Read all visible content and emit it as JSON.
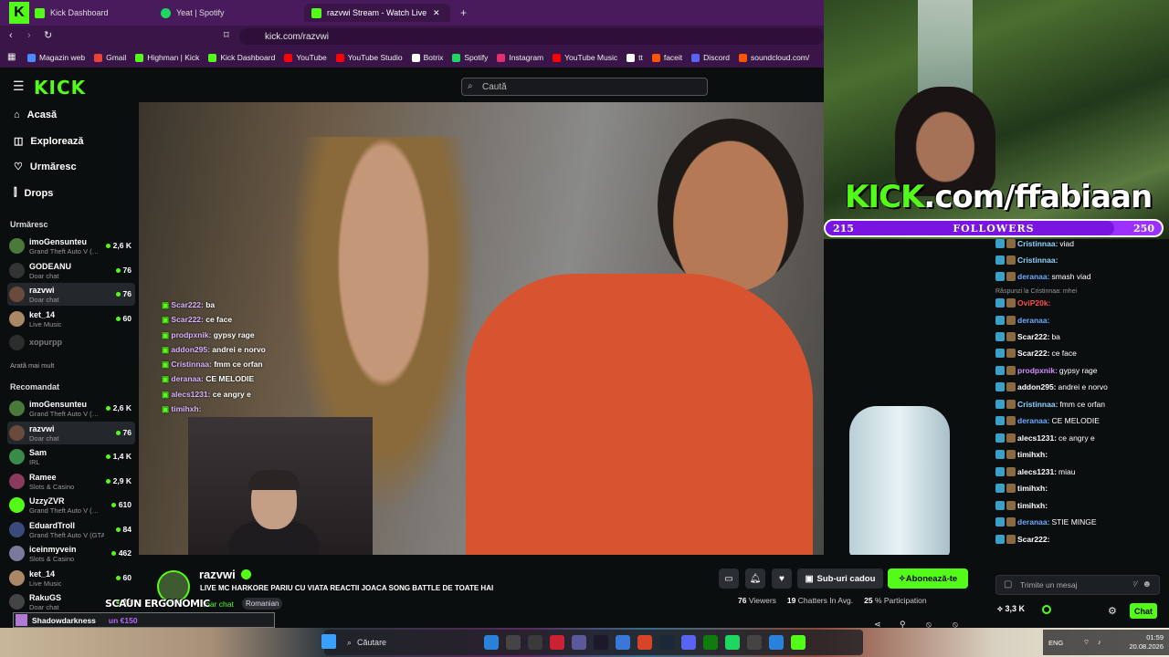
{
  "browser": {
    "tabs": [
      {
        "label": "Kick Dashboard"
      },
      {
        "label": "Yeat | Spotify"
      },
      {
        "label": "razvwi Stream - Watch Live on Kick"
      }
    ],
    "url": "kick.com/razvwi",
    "bookmarks": [
      {
        "label": "Magazin web",
        "color": "#4a8cff"
      },
      {
        "label": "Gmail",
        "color": "#ea4335"
      },
      {
        "label": "Highman | Kick",
        "color": "#53fc18"
      },
      {
        "label": "Kick Dashboard",
        "color": "#53fc18"
      },
      {
        "label": "YouTube",
        "color": "#ff0000"
      },
      {
        "label": "YouTube Studio",
        "color": "#ff0000"
      },
      {
        "label": "Botrix",
        "color": "#ffffff"
      },
      {
        "label": "Spotify",
        "color": "#1ed760"
      },
      {
        "label": "Instagram",
        "color": "#e1306c"
      },
      {
        "label": "YouTube Music",
        "color": "#ff0000"
      },
      {
        "label": "tt",
        "color": "#ffffff"
      },
      {
        "label": "faceit",
        "color": "#ff5500"
      },
      {
        "label": "Discord",
        "color": "#5865f2"
      },
      {
        "label": "soundcloud.com/",
        "color": "#ff5500"
      }
    ]
  },
  "header": {
    "logo": "KICK",
    "search_placeholder": "Caută"
  },
  "sidebar": {
    "nav": [
      {
        "label": "Acasă",
        "icon": "home-icon"
      },
      {
        "label": "Explorează",
        "icon": "compass-icon"
      },
      {
        "label": "Urmăresc",
        "icon": "heart-icon"
      },
      {
        "label": "Drops",
        "icon": "drops-icon"
      }
    ],
    "following_title": "Urmăresc",
    "following": [
      {
        "name": "imoGensunteu",
        "game": "Grand Theft Auto V (…",
        "viewers": "2,6 K",
        "color": "#4a7a3a"
      },
      {
        "name": "GODEANU",
        "game": "Doar chat",
        "viewers": "76",
        "color": "#333"
      },
      {
        "name": "razvwi",
        "game": "Doar chat",
        "viewers": "76",
        "color": "#6a4a3a"
      },
      {
        "name": "ket_14",
        "game": "Live Music",
        "viewers": "60",
        "color": "#aa8866"
      },
      {
        "name": "xopurpp",
        "game": "",
        "viewers": "",
        "color": "#555"
      }
    ],
    "show_more": "Arată mai mult",
    "recommended_title": "Recomandat",
    "recommended": [
      {
        "name": "imoGensunteu",
        "game": "Grand Theft Auto V (…",
        "viewers": "2,6 K",
        "color": "#4a7a3a"
      },
      {
        "name": "razvwi",
        "game": "Doar chat",
        "viewers": "76",
        "color": "#6a4a3a"
      },
      {
        "name": "Sam",
        "game": "IRL",
        "viewers": "1,4 K",
        "color": "#3a8a4a"
      },
      {
        "name": "Ramee",
        "game": "Slots & Casino",
        "viewers": "2,9 K",
        "color": "#8a3a5a"
      },
      {
        "name": "UzzyZVR",
        "game": "Grand Theft Auto V (…",
        "viewers": "610",
        "color": "#53fc18"
      },
      {
        "name": "EduardTroll",
        "game": "Grand Theft Auto V (GTA)",
        "viewers": "84",
        "color": "#3a4a7a"
      },
      {
        "name": "iceinmyvein",
        "game": "Slots & Casino",
        "viewers": "462",
        "color": "#7a7a9a"
      },
      {
        "name": "ket_14",
        "game": "Live Music",
        "viewers": "60",
        "color": "#aa8866"
      },
      {
        "name": "RakuGS",
        "game": "Doar chat",
        "viewers": "15",
        "color": "#444"
      }
    ]
  },
  "overlay_chat": [
    {
      "user": "Scar222:",
      "msg": "ba"
    },
    {
      "user": "Scar222:",
      "msg": "ce face"
    },
    {
      "user": "prodpxnik:",
      "msg": "gypsy rage"
    },
    {
      "user": "addon295:",
      "msg": "andrei e norvo"
    },
    {
      "user": "Cristinnaa:",
      "msg": "fmm ce orfan"
    },
    {
      "user": "deranaa:",
      "msg": "CE MELODIE"
    },
    {
      "user": "alecs1231:",
      "msg": "ce angry e"
    },
    {
      "user": "timihxh:",
      "msg": ""
    }
  ],
  "overlay": {
    "kick_prefix": "KICK",
    "kick_suffix": ".com/ffabiaan",
    "followers_current": "215",
    "followers_label": "FOLLOWERS",
    "followers_goal": "250",
    "followers_progress": 0.86
  },
  "chat": {
    "reply_note": "Răspunzi la Cristinnaa: mhei",
    "messages": [
      {
        "user": "Cristinnaa:",
        "msg": "viad",
        "color": "#8fd3ff"
      },
      {
        "user": "Cristinnaa:",
        "msg": "",
        "color": "#8fd3ff"
      },
      {
        "user": "deranaa:",
        "msg": "smash viad",
        "color": "#6fa8ff"
      },
      {
        "user": "OviP20k:",
        "msg": "",
        "color": "#ff4d4d"
      },
      {
        "user": "deranaa:",
        "msg": "",
        "color": "#6fa8ff"
      },
      {
        "user": "Scar222:",
        "msg": "ba",
        "color": "#ffffff"
      },
      {
        "user": "Scar222:",
        "msg": "ce face",
        "color": "#ffffff"
      },
      {
        "user": "prodpxnik:",
        "msg": "gypsy rage",
        "color": "#d28cff"
      },
      {
        "user": "addon295:",
        "msg": "andrei e norvo",
        "color": "#ffffff"
      },
      {
        "user": "Cristinnaa:",
        "msg": "fmm ce orfan",
        "color": "#8fd3ff"
      },
      {
        "user": "deranaa:",
        "msg": "CE MELODIE",
        "color": "#6fa8ff"
      },
      {
        "user": "alecs1231:",
        "msg": "ce angry e",
        "color": "#ffffff"
      },
      {
        "user": "timihxh:",
        "msg": "",
        "color": "#ffffff"
      },
      {
        "user": "alecs1231:",
        "msg": "miau",
        "color": "#ffffff"
      },
      {
        "user": "timihxh:",
        "msg": "",
        "color": "#ffffff"
      },
      {
        "user": "timihxh:",
        "msg": "",
        "color": "#ffffff"
      },
      {
        "user": "deranaa:",
        "msg": "STIE MINGE",
        "color": "#6fa8ff"
      },
      {
        "user": "Scar222:",
        "msg": "",
        "color": "#ffffff"
      }
    ],
    "input_placeholder": "Trimite un mesaj",
    "points": "3,3 K",
    "send_label": "Chat"
  },
  "stream": {
    "name": "razvwi",
    "title": "LIVE MC HARKORE PARIU CU VIATA REACTII JOACA SONG BATTLE DE TOATE HAI",
    "category": "Doar chat",
    "language": "Romanian",
    "subgift_label": "Sub-uri cadou",
    "subscribe_label": "Abonează-te",
    "viewers": "76",
    "viewers_label": "Viewers",
    "chatters": "19",
    "chatters_label": "Chatters In Avg.",
    "participation": "25",
    "participation_label": "% Participation"
  },
  "obs": {
    "chair_text": "SCAUN ERGONOMIC",
    "alert_user": "Shadowdarkness",
    "alert_amount": "un €150"
  },
  "taskbar": {
    "search_label": "Căutare",
    "lang": "ENG",
    "time": "01:59",
    "date": "20.08.2026"
  }
}
